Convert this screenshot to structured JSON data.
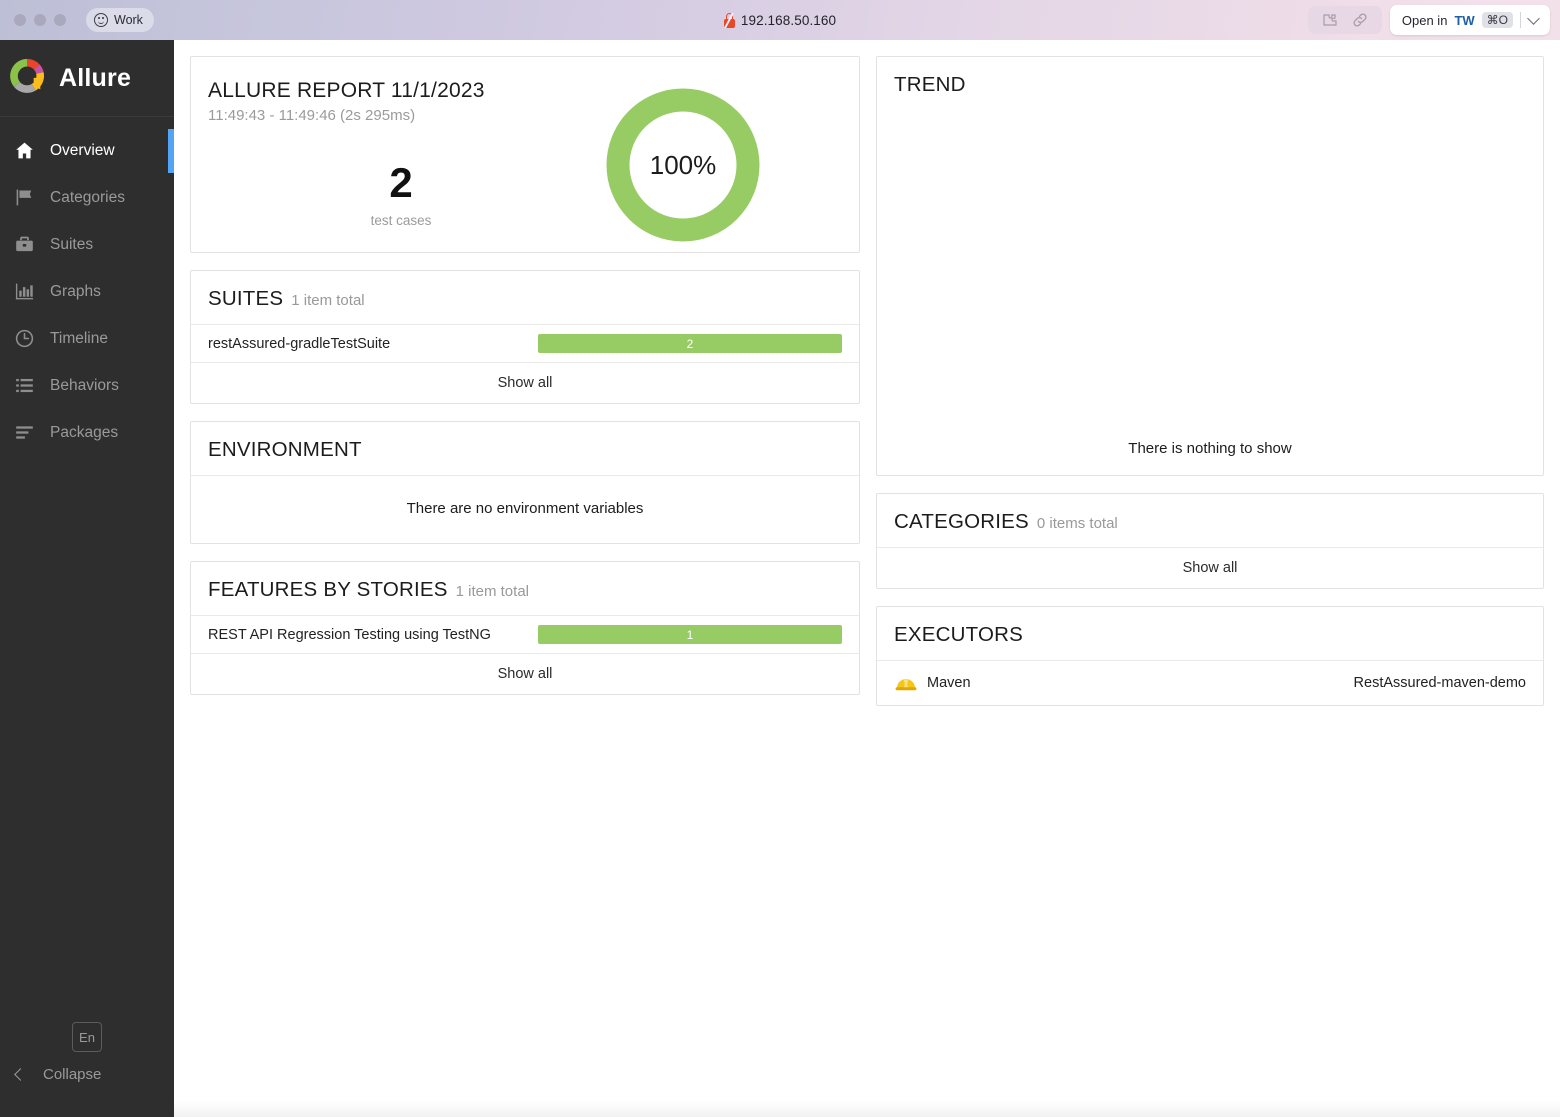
{
  "browser": {
    "tab_label": "Work",
    "tab_icon": "smiley-icon",
    "url": "192.168.50.160",
    "url_icon": "insecure-lock-icon",
    "extensions_icon": "puzzle-icon",
    "link_icon": "link-icon",
    "open_button": {
      "label": "Open in",
      "app": "TW",
      "shortcut": "⌘O",
      "chevron": "chevron-down-icon"
    }
  },
  "sidebar": {
    "brand": "Allure",
    "logo_icon": "allure-donut-logo",
    "items": [
      {
        "label": "Overview",
        "icon": "home-icon",
        "active": true
      },
      {
        "label": "Categories",
        "icon": "flag-icon",
        "active": false
      },
      {
        "label": "Suites",
        "icon": "briefcase-icon",
        "active": false
      },
      {
        "label": "Graphs",
        "icon": "bar-chart-icon",
        "active": false
      },
      {
        "label": "Timeline",
        "icon": "clock-icon",
        "active": false
      },
      {
        "label": "Behaviors",
        "icon": "list-icon",
        "active": false
      },
      {
        "label": "Packages",
        "icon": "lines-icon",
        "active": false
      }
    ],
    "language_button": "En",
    "collapse_label": "Collapse",
    "collapse_icon": "chevron-left-icon",
    "active_accent_color": "#54a4f5",
    "background_color": "#2e2e2e"
  },
  "report": {
    "title": "ALLURE REPORT 11/1/2023",
    "time_range": "11:49:43 - 11:49:46 (2s 295ms)",
    "test_cases_count": "2",
    "test_cases_label": "test cases",
    "pass_percent": "100%",
    "donut_color": "#97cc64"
  },
  "suites": {
    "title": "SUITES",
    "subtitle": "1 item total",
    "rows": [
      {
        "label": "restAssured-gradleTestSuite",
        "value": "2",
        "color": "#97cc64"
      }
    ],
    "show_all": "Show all"
  },
  "environment": {
    "title": "ENVIRONMENT",
    "empty_message": "There are no environment variables"
  },
  "features": {
    "title": "FEATURES BY STORIES",
    "subtitle": "1 item total",
    "rows": [
      {
        "label": "REST API Regression Testing using TestNG",
        "value": "1",
        "color": "#97cc64"
      }
    ],
    "show_all": "Show all"
  },
  "trend": {
    "title": "TREND",
    "empty_message": "There is nothing to show"
  },
  "categories": {
    "title": "CATEGORIES",
    "subtitle": "0 items total",
    "show_all": "Show all"
  },
  "executors": {
    "title": "EXECUTORS",
    "rows": [
      {
        "icon": "helmet-icon",
        "name": "Maven",
        "build": "RestAssured-maven-demo"
      }
    ]
  }
}
